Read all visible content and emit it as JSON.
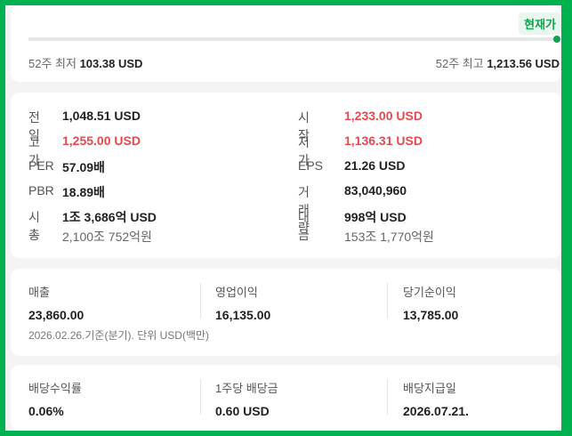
{
  "range": {
    "now_badge": "현재가",
    "low_label": "52주 최저",
    "low_value": "103.38 USD",
    "high_label": "52주 최고",
    "high_value": "1,213.56 USD",
    "current_position_fraction": 1.0
  },
  "price": {
    "prev_close_label": "전일",
    "prev_close_value": "1,048.51 USD",
    "open_label": "시작",
    "open_value": "1,233.00 USD",
    "high_label": "고가",
    "high_value": "1,255.00 USD",
    "low_label": "저가",
    "low_value": "1,136.31 USD",
    "per_label": "PER",
    "per_value": "57.09배",
    "eps_label": "EPS",
    "eps_value": "21.26 USD",
    "pbr_label": "PBR",
    "pbr_value": "18.89배",
    "volume_label": "거래량",
    "volume_value": "83,040,960",
    "mcap_label": "시총",
    "mcap_value": "1조 3,686억 USD",
    "mcap_krw": "2,100조 752억원",
    "amount_label": "대금",
    "amount_value": "998억 USD",
    "amount_krw": "153조 1,770억원"
  },
  "finance": {
    "items": [
      {
        "label": "매출",
        "value": "23,860.00"
      },
      {
        "label": "영업이익",
        "value": "16,135.00"
      },
      {
        "label": "당기순이익",
        "value": "13,785.00"
      }
    ],
    "note": "2026.02.26.기준(분기). 단위 USD(백만)"
  },
  "dividend": {
    "items": [
      {
        "label": "배당수익률",
        "value": "0.06%"
      },
      {
        "label": "1주당 배당금",
        "value": "0.60 USD"
      },
      {
        "label": "배당지급일",
        "value": "2026.07.21."
      }
    ]
  },
  "colors": {
    "accent": "#12a150",
    "up": "#e8484f",
    "frame": "#00b14f"
  }
}
